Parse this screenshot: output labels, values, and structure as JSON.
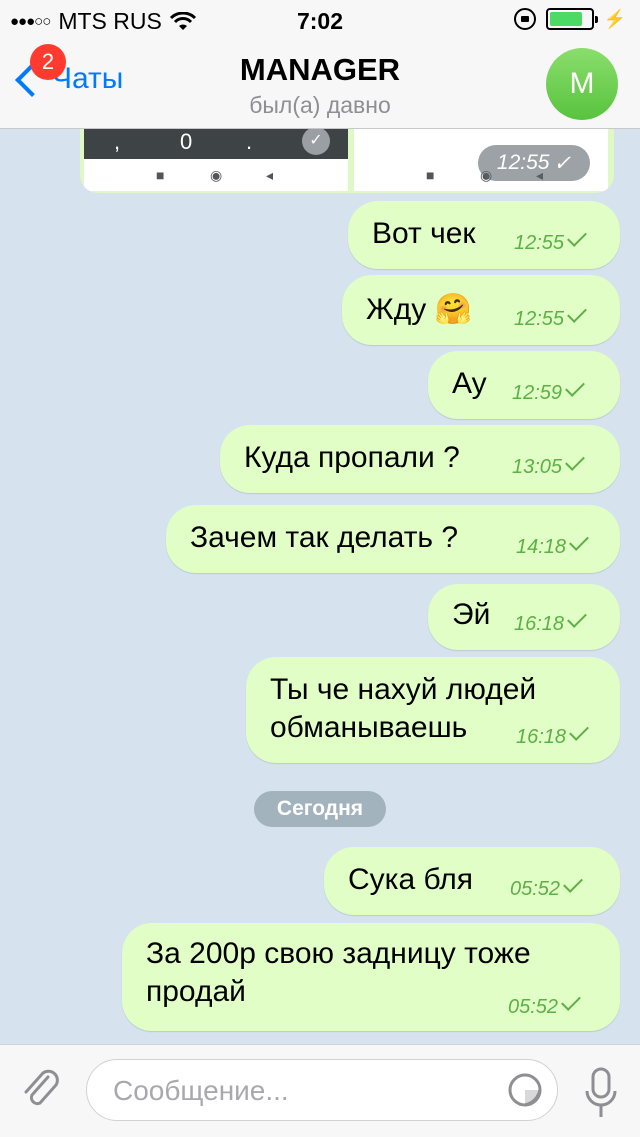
{
  "status_bar": {
    "signal_dots": "●●●○○",
    "carrier": "MTS RUS",
    "time": "7:02",
    "battery_level": 0.8
  },
  "nav": {
    "back_label": "Чаты",
    "badge_count": "2",
    "title": "MANAGER",
    "subtitle": "был(а) давно",
    "avatar_letter": "M"
  },
  "image_message": {
    "keypad_keys": [
      ",",
      "0",
      "."
    ],
    "nav_buttons": [
      "■",
      "◉",
      "◂"
    ],
    "time": "12:55"
  },
  "messages": [
    {
      "text": "Вот чек",
      "time": "12:55"
    },
    {
      "text": "Жду 🤗",
      "time": "12:55"
    },
    {
      "text": "Ау",
      "time": "12:59"
    },
    {
      "text": "Куда пропали ?",
      "time": "13:05"
    },
    {
      "text": "Зачем так делать ?",
      "time": "14:18"
    },
    {
      "text": "Эй",
      "time": "16:18"
    },
    {
      "text": "Ты че нахуй людей обманываешь",
      "time": "16:18"
    },
    {
      "text": "Сука бля",
      "time": "05:52"
    },
    {
      "text": "За 200р свою задницу тоже продай",
      "time": "05:52"
    }
  ],
  "date_separator": "Сегодня",
  "input": {
    "placeholder": "Сообщение..."
  },
  "icons": {
    "attach": "paperclip-icon",
    "sticker": "sticker-icon",
    "mic": "microphone-icon",
    "wifi": "wifi-icon",
    "lock": "rotation-lock-icon"
  },
  "colors": {
    "bubble": "#e1fec6",
    "time_green": "#5db046",
    "accent": "#007aff",
    "badge": "#ff3b30"
  }
}
